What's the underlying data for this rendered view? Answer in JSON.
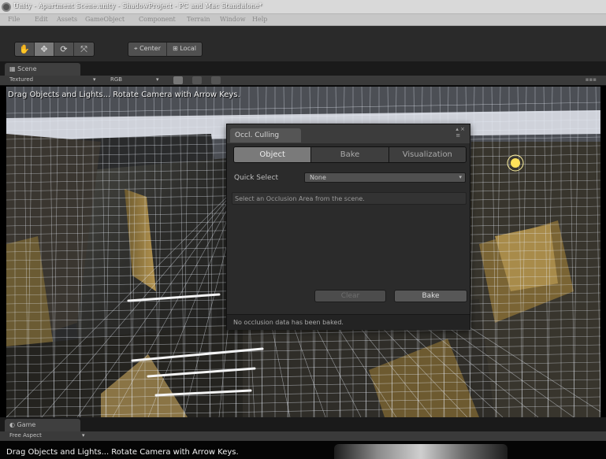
{
  "window": {
    "title": "Unity - Apartment Scene.unity - ShadowProject - PC and Mac Standalone*"
  },
  "menu": [
    "File",
    "Edit",
    "Assets",
    "GameObject",
    "Component",
    "Terrain",
    "Window",
    "Help"
  ],
  "toolbar": {
    "tools": [
      "hand-tool",
      "move-tool",
      "rotate-tool",
      "scale-tool"
    ],
    "pivot_label": "Center",
    "space_label": "Local"
  },
  "scene_view": {
    "tab_label": "Scene",
    "render_mode": "Textured",
    "color_mode": "RGB",
    "hint": "Drag Objects and Lights... Rotate Camera with Arrow Keys."
  },
  "occlusion_panel": {
    "tab_label": "Occl. Culling",
    "tabs": [
      "Object",
      "Bake",
      "Visualization"
    ],
    "active_tab": "Object",
    "quick_select_label": "Quick Select",
    "quick_select_value": "None",
    "help_text": "Select an Occlusion Area from the scene.",
    "clear_label": "Clear",
    "bake_label": "Bake",
    "status_text": "No occlusion data has been baked."
  },
  "game_view": {
    "tab_label": "Game",
    "aspect": "Free Aspect",
    "hint": "Drag Objects and Lights... Rotate Camera with Arrow Keys."
  },
  "colors": {
    "wireframe": "#e8ecf6",
    "wall_beam": "#c8b06a",
    "light_gizmo": "#ffe25a",
    "panel_bg": "#2b2b2b",
    "active_tab": "#7a7a7a"
  }
}
